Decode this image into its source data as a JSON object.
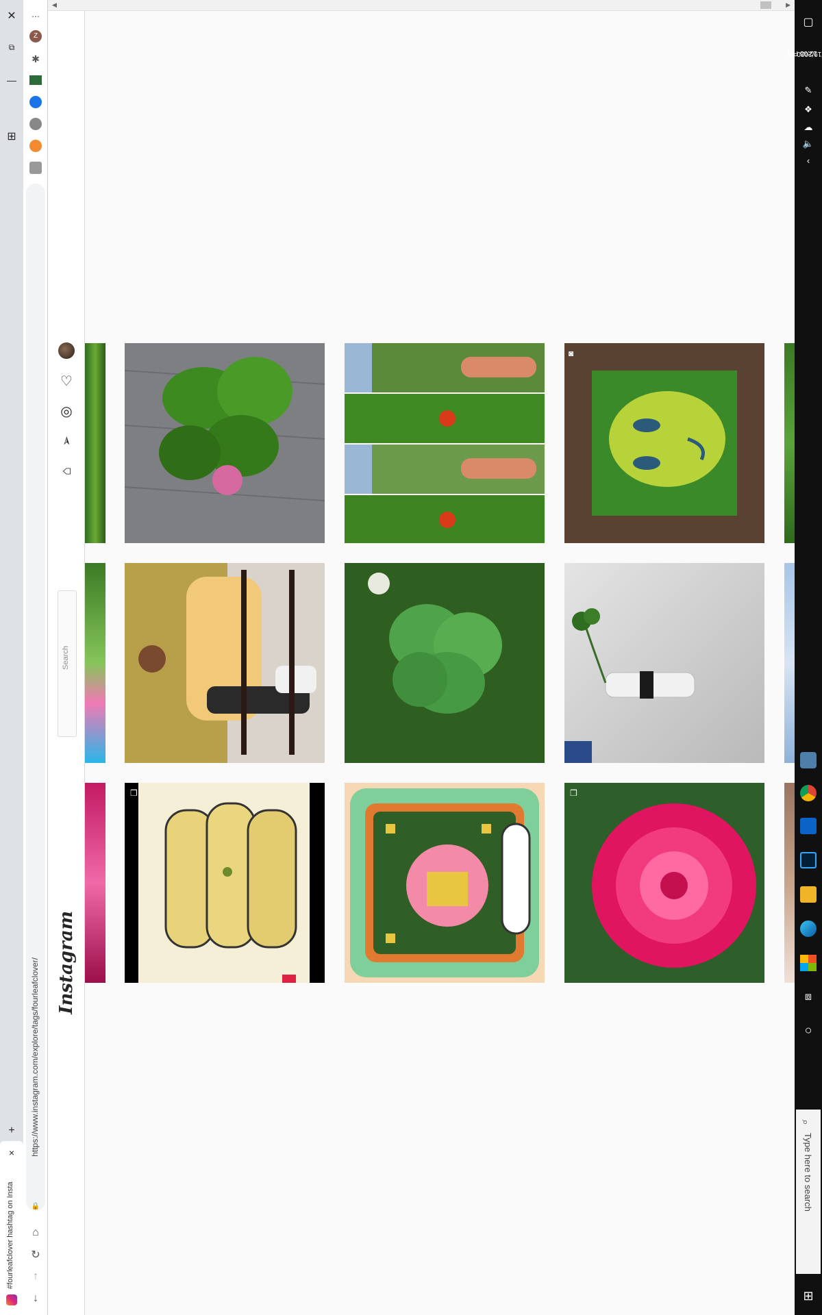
{
  "browser": {
    "tab_title": "#fourleafclover hashtag on Insta",
    "url": "https://www.instagram.com/explore/tags/fourleafclover/",
    "new_tab_label": "+",
    "close_label": "×",
    "menu_label": "...",
    "ext_avatar_label": "Z"
  },
  "instagram": {
    "logo": "Instagram",
    "search_placeholder": "Search"
  },
  "taskbar": {
    "time": "12:05 PM",
    "date": "7/19/2020",
    "search_placeholder": "Type here to search"
  },
  "colors": {
    "accent_badge": "#e1306c",
    "chrome_bg": "#dee1e6",
    "taskbar_bg": "#101010"
  }
}
